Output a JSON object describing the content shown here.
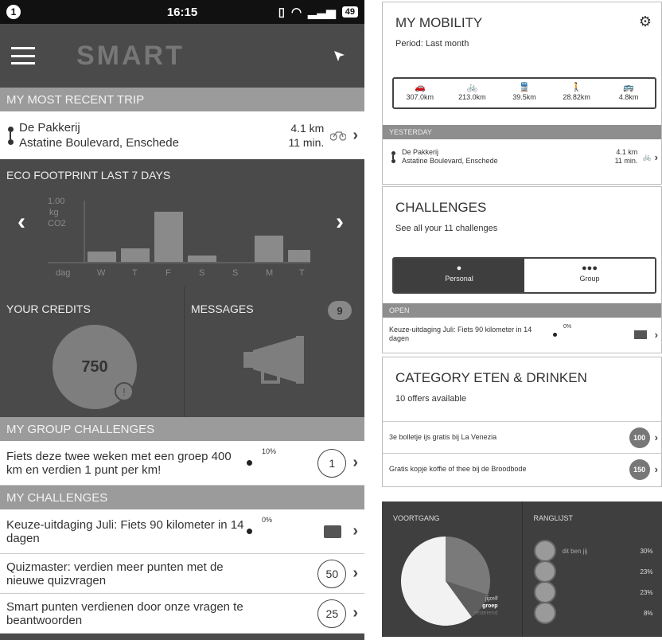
{
  "left": {
    "status": {
      "notif": "1",
      "time": "16:15",
      "battery": "49"
    },
    "app": {
      "logo": "SMART"
    },
    "recent_trip": {
      "header": "MY MOST RECENT TRIP",
      "from": "De Pakkerij",
      "to": "Astatine Boulevard, Enschede",
      "distance": "4.1 km",
      "duration": "11 min."
    },
    "eco": {
      "title": "ECO FOOTPRINT LAST 7 DAYS",
      "unit_value": "1.00",
      "unit_line1": "kg",
      "unit_line2": "CO2",
      "x_label": "dag"
    },
    "credits": {
      "title": "YOUR CREDITS",
      "value": "750",
      "info": "!"
    },
    "messages": {
      "title": "MESSAGES",
      "count": "9"
    },
    "group_challenges": {
      "header": "MY GROUP CHALLENGES",
      "items": [
        {
          "text": "Fiets deze twee weken met een groep 400 km en verdien 1 punt per km!",
          "pct": "10%",
          "points": "1"
        }
      ]
    },
    "challenges": {
      "header": "MY CHALLENGES",
      "items": [
        {
          "text": "Keuze-uitdaging Juli: Fiets 90 kilometer in 14 dagen",
          "pct": "0%"
        },
        {
          "text": "Quizmaster: verdien meer punten met de nieuwe quizvragen",
          "points": "50"
        },
        {
          "text": "Smart punten verdienen door onze vragen te beantwoorden",
          "points": "25"
        }
      ]
    }
  },
  "right": {
    "mobility": {
      "title": "MY MOBILITY",
      "period": "Period: Last month",
      "modes": [
        {
          "icon": "car-icon",
          "glyph": "🚗",
          "value": "307.0km"
        },
        {
          "icon": "bike-icon",
          "glyph": "🚲",
          "value": "213.0km"
        },
        {
          "icon": "train-icon",
          "glyph": "🚆",
          "value": "39.5km"
        },
        {
          "icon": "walk-icon",
          "glyph": "🚶",
          "value": "28.82km"
        },
        {
          "icon": "bus-icon",
          "glyph": "🚌",
          "value": "4.8km"
        }
      ],
      "yesterday_header": "YESTERDAY",
      "trip_from": "De Pakkerij",
      "trip_to": "Astatine Boulevard, Enschede",
      "trip_distance": "4.1 km",
      "trip_duration": "11 min."
    },
    "challenges": {
      "title": "CHALLENGES",
      "subtitle": "See all your 11 challenges",
      "tab_personal": "Personal",
      "tab_group": "Group",
      "open_header": "OPEN",
      "item_text": "Keuze-uitdaging Juli: Fiets 90 kilometer in 14 dagen",
      "item_pct": "0%"
    },
    "category": {
      "title": "CATEGORY ETEN & DRINKEN",
      "subtitle": "10 offers available",
      "offers": [
        {
          "text": "3e bolletje ijs gratis bij La Venezia",
          "points": "100"
        },
        {
          "text": "Gratis kopje koffie of thee bij de Broodbode",
          "points": "150"
        }
      ]
    },
    "progress": {
      "voortgang": "VOORTGANG",
      "ranglijst": "RANGLIJST",
      "legend_self": "jijzelf",
      "legend_group": "groep",
      "legend_rest": "resterend",
      "pie_self": 0.3,
      "pie_group": 0.1,
      "ranking": [
        {
          "name": "dit ben jij",
          "pct": "30%"
        },
        {
          "name": "",
          "pct": "23%"
        },
        {
          "name": "",
          "pct": "23%"
        },
        {
          "name": "",
          "pct": "8%"
        }
      ]
    }
  },
  "colors": {
    "dark": "#4a4a4a",
    "section": "#9b9b9b",
    "badge": "#777777"
  }
}
